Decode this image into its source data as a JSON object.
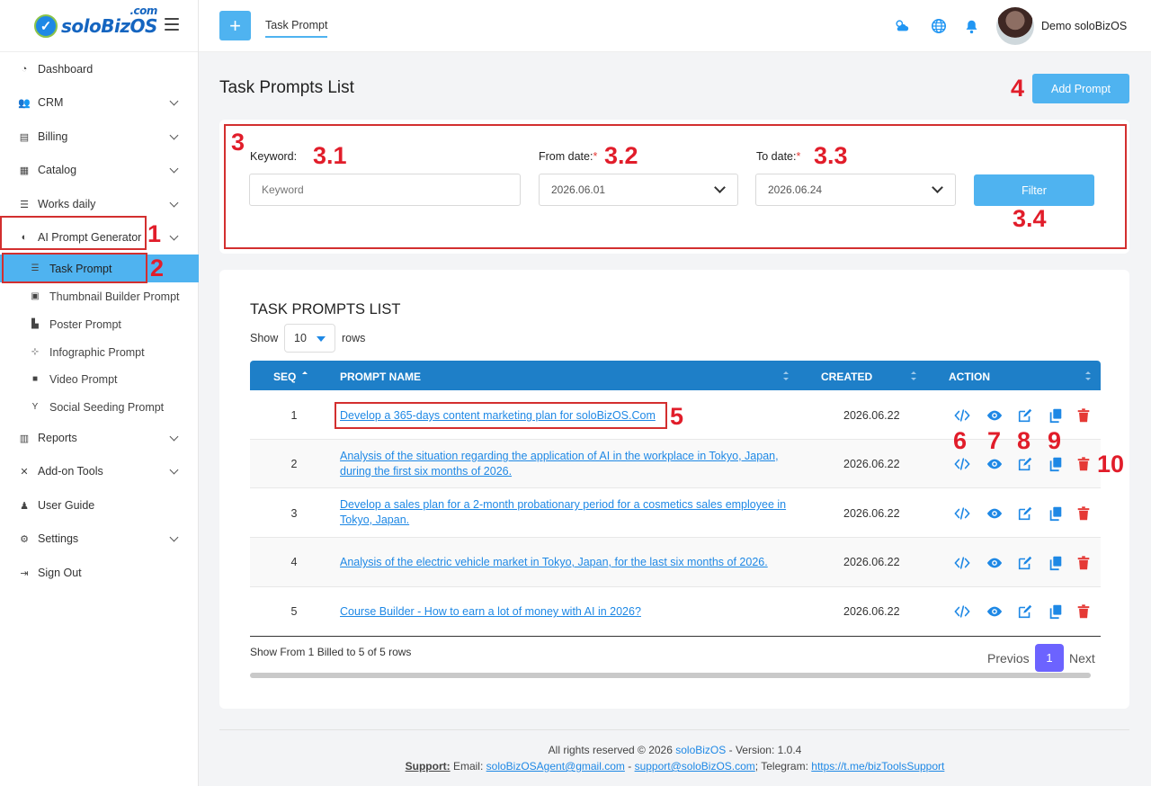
{
  "app": {
    "logo_text": "soloBizOS",
    "logo_suffix": ".com",
    "user_name": "Demo soloBizOS",
    "top_tab": "Task Prompt"
  },
  "sidebar": {
    "items": [
      {
        "label": "Dashboard",
        "icon": "pie-chart-icon"
      },
      {
        "label": "CRM",
        "icon": "users-icon"
      },
      {
        "label": "Billing",
        "icon": "invoice-icon"
      },
      {
        "label": "Catalog",
        "icon": "calendar-icon"
      },
      {
        "label": "Works daily",
        "icon": "checklist-icon"
      },
      {
        "label": "AI Prompt Generator",
        "icon": "brain-icon"
      },
      {
        "label": "Reports",
        "icon": "report-icon"
      },
      {
        "label": "Add-on Tools",
        "icon": "tools-icon"
      },
      {
        "label": "User Guide",
        "icon": "guide-icon"
      },
      {
        "label": "Settings",
        "icon": "gear-icon"
      },
      {
        "label": "Sign Out",
        "icon": "sign-out-icon"
      }
    ],
    "sub_items": [
      {
        "label": "Task Prompt",
        "icon": "tasks-icon"
      },
      {
        "label": "Thumbnail Builder Prompt",
        "icon": "image-icon"
      },
      {
        "label": "Poster Prompt",
        "icon": "poster-icon"
      },
      {
        "label": "Infographic Prompt",
        "icon": "diagram-icon"
      },
      {
        "label": "Video Prompt",
        "icon": "video-icon"
      },
      {
        "label": "Social Seeding Prompt",
        "icon": "seedling-icon"
      }
    ]
  },
  "page": {
    "title": "Task Prompts List",
    "add_button": "Add Prompt"
  },
  "filter": {
    "keyword_label": "Keyword:",
    "keyword_placeholder": "Keyword",
    "from_label": "From date:",
    "from_value": "2026.06.01",
    "to_label": "To date:",
    "to_value": "2026.06.24",
    "required_mark": "*",
    "button": "Filter"
  },
  "list": {
    "title": "TASK PROMPTS LIST",
    "show_label": "Show",
    "rows_label": "rows",
    "page_size": "10",
    "columns": {
      "seq": "SEQ",
      "name": "PROMPT NAME",
      "created": "CREATED",
      "action": "ACTION"
    },
    "rows": [
      {
        "seq": "1",
        "name": "Develop a 365-days content marketing plan for soloBizOS.Com",
        "created": "2026.06.22"
      },
      {
        "seq": "2",
        "name": "Analysis of the situation regarding the application of AI in the workplace in Tokyo, Japan, during the first six months of 2026.",
        "created": "2026.06.22"
      },
      {
        "seq": "3",
        "name": "Develop a sales plan for a 2-month probationary period for a cosmetics sales employee in Tokyo, Japan.",
        "created": "2026.06.22"
      },
      {
        "seq": "4",
        "name": "Analysis of the electric vehicle market in Tokyo, Japan, for the last six months of 2026.",
        "created": "2026.06.22"
      },
      {
        "seq": "5",
        "name": "Course Builder - How to earn a lot of money with AI in 2026?",
        "created": "2026.06.22"
      }
    ],
    "footer_text": "Show From 1 Billed to 5 of 5 rows",
    "prev": "Previos",
    "current_page": "1",
    "next": "Next"
  },
  "annotations": [
    "1",
    "2",
    "3",
    "3.1",
    "3.2",
    "3.3",
    "3.4",
    "4",
    "5",
    "6",
    "7",
    "8",
    "9",
    "10"
  ],
  "footer": {
    "rights": "All rights reserved © 2026",
    "brand": "soloBizOS",
    "version": " - Version: 1.0.4",
    "support_label": "Support:",
    "email_label": " Email: ",
    "email1": "soloBizOSAgent@gmail.com",
    "sep": " - ",
    "email2": "support@soloBizOS.com",
    "telegram_label": "; Telegram: ",
    "telegram": "https://t.me/bizToolsSupport"
  },
  "colors": {
    "accent": "#4fb3f0",
    "header": "#1e7fc8",
    "annotation": "#e11d2a",
    "delete": "#e53935"
  }
}
